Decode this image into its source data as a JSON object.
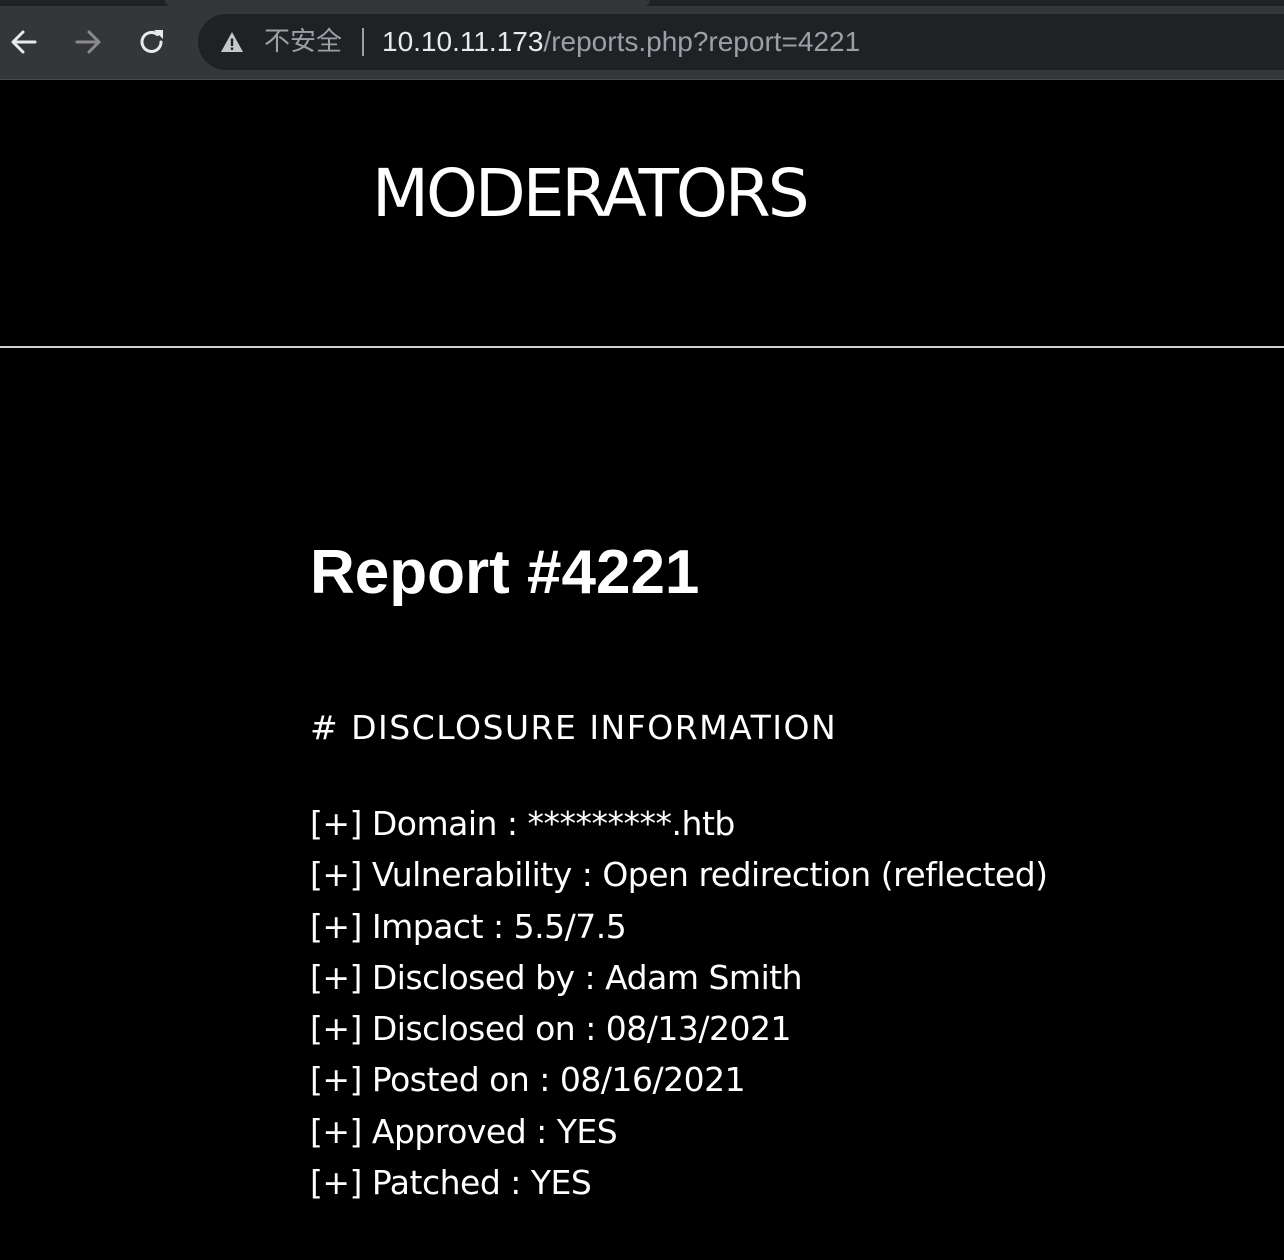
{
  "browser": {
    "security_label": "不安全",
    "url_host": "10.10.11.173",
    "url_path": "/reports.php?report=4221",
    "icons": {
      "back": "arrow-left-icon",
      "forward": "arrow-right-icon",
      "reload": "reload-icon",
      "warning": "warning-triangle-icon"
    }
  },
  "site": {
    "title": "MODERATORS"
  },
  "report": {
    "title": "Report #4221",
    "section_heading": "# DISCLOSURE INFORMATION",
    "details": [
      "[+] Domain : *********.htb",
      "[+] Vulnerability : Open redirection (reflected)",
      "[+] Impact : 5.5/7.5",
      "[+] Disclosed by : Adam Smith",
      "[+] Disclosed on : 08/13/2021",
      "[+] Posted on : 08/16/2021",
      "[+] Approved : YES",
      "[+] Patched : YES"
    ]
  },
  "colors": {
    "page_background": "#000000",
    "text": "#ffffff",
    "chrome_background": "#35363a",
    "omnibox_background": "#202124",
    "url_host": "#e8eaed",
    "url_dim": "#9aa0a6"
  }
}
